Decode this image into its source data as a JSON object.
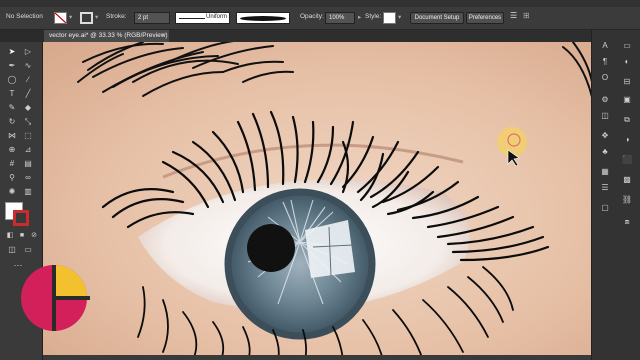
{
  "control_bar": {
    "selection_status": "No Selection",
    "stroke_label": "Stroke:",
    "stroke_weight": "2 pt",
    "profile": "Uniform",
    "opacity_label": "Opacity:",
    "opacity_value": "100%",
    "style_label": "Style:",
    "document_setup": "Document Setup",
    "preferences": "Preferences"
  },
  "document_tab": {
    "title": "vector eye.ai* @ 33.33 % (RGB/Preview)",
    "close": "×"
  },
  "colors": {
    "fill": "#ffffff",
    "stroke": "#cc2b2b",
    "iris": "#5f7684",
    "logo_magenta": "#d31f5a",
    "logo_yellow": "#f3c12e",
    "cursor_highlight": "#f2d06b"
  },
  "tools": [
    "selection-tool",
    "direct-selection-tool",
    "pen-tool",
    "curvature-tool",
    "ellipse-tool",
    "brush-tool",
    "type-tool",
    "line-tool",
    "pencil-tool",
    "eraser-tool",
    "rotate-tool",
    "scale-tool",
    "width-tool",
    "free-transform-tool",
    "shape-builder-tool",
    "perspective-tool",
    "mesh-tool",
    "gradient-tool",
    "eyedropper-tool",
    "blend-tool",
    "symbol-sprayer-tool",
    "graph-tool",
    "artboard-tool",
    "slice-tool",
    "hand-tool",
    "zoom-tool"
  ],
  "right_panels": [
    "character-panel",
    "paragraph-panel",
    "opentype-panel",
    "libraries-panel",
    "properties-panel",
    "layers-panel",
    "brushes-panel",
    "symbols-panel",
    "swatches-panel",
    "stroke-panel",
    "transparency-panel",
    "appearance-panel",
    "graphic-styles-panel",
    "links-panel",
    "comments-panel"
  ]
}
